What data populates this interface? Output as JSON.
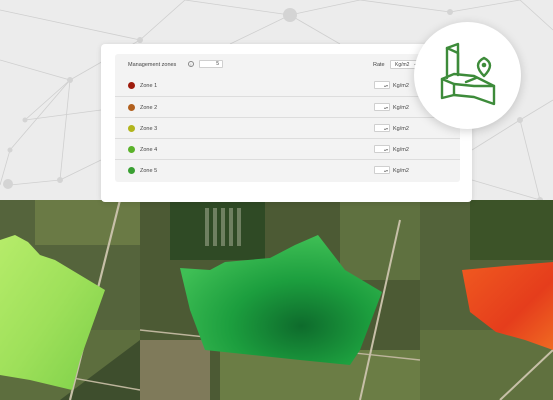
{
  "header": {
    "label": "Management zones",
    "count": "5",
    "rate_label": "Rate",
    "unit": "Kg/m2"
  },
  "zones": [
    {
      "name": "Zone 1",
      "color": "#9e1b0c",
      "unit": "Kg/m2"
    },
    {
      "name": "Zone 2",
      "color": "#b2601e",
      "unit": "Kg/m2"
    },
    {
      "name": "Zone 3",
      "color": "#b2b51d",
      "unit": "Kg/m2"
    },
    {
      "name": "Zone 4",
      "color": "#5ab22a",
      "unit": "Kg/m2"
    },
    {
      "name": "Zone 5",
      "color": "#3aa033",
      "unit": "Kg/m2"
    }
  ],
  "icons": {
    "info": "info-icon",
    "field_location": "field-location-pin-icon",
    "dropdown": "chevron-down-icon"
  },
  "colors": {
    "brand_green": "#3d8b3a"
  }
}
